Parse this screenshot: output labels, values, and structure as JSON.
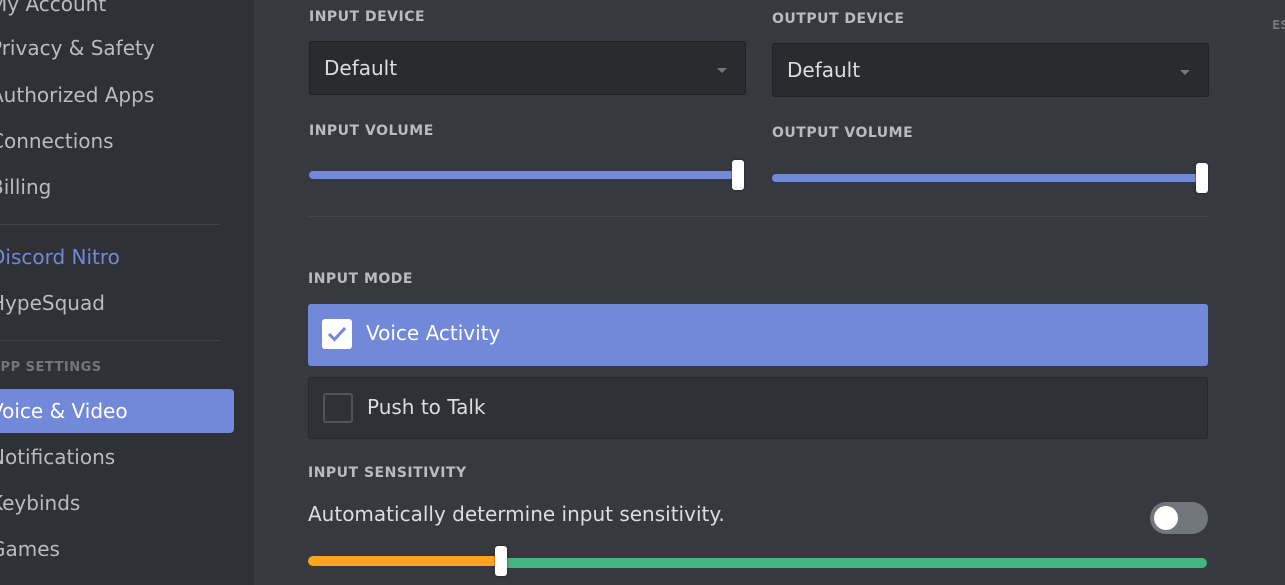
{
  "sidebar": {
    "items": [
      {
        "label": "My Account"
      },
      {
        "label": "Privacy & Safety"
      },
      {
        "label": "Authorized Apps"
      },
      {
        "label": "Connections"
      },
      {
        "label": "Billing"
      },
      {
        "label": "Discord Nitro"
      },
      {
        "label": "HypeSquad"
      },
      {
        "label": "Voice & Video"
      },
      {
        "label": "Notifications"
      },
      {
        "label": "Keybinds"
      },
      {
        "label": "Games"
      }
    ],
    "app_settings_header": "APP SETTINGS",
    "active_item": "Voice & Video"
  },
  "voice": {
    "input_device": {
      "label": "INPUT DEVICE",
      "value": "Default"
    },
    "output_device": {
      "label": "OUTPUT DEVICE",
      "value": "Default"
    },
    "input_volume": {
      "label": "INPUT VOLUME",
      "level_percent": 100
    },
    "output_volume": {
      "label": "OUTPUT VOLUME",
      "level_percent": 100
    },
    "input_mode": {
      "label": "INPUT MODE",
      "options": [
        {
          "label": "Voice Activity",
          "checked": true
        },
        {
          "label": "Push to Talk",
          "checked": false
        }
      ]
    },
    "input_sensitivity": {
      "label": "INPUT SENSITIVITY",
      "auto_label": "Automatically determine input sensitivity.",
      "auto_enabled": false,
      "threshold_percent": 21
    }
  },
  "close": {
    "esc_label": "ESC"
  },
  "colors": {
    "accent": "#7289da",
    "sensitivity_low": "#faa61a",
    "sensitivity_high": "#43b581"
  }
}
